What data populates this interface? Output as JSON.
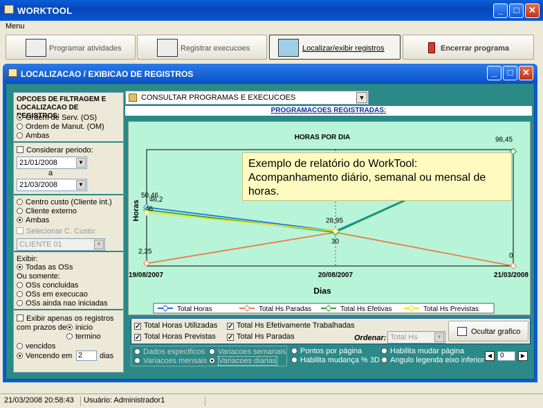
{
  "app": {
    "title": "WORKTOOL"
  },
  "menu": {
    "label": "Menu"
  },
  "toolbar": {
    "btn1": "Programar atividades",
    "btn2": "Registrar execucoes",
    "btn3": "Localizar/exibir registros",
    "btn4": "Encerrar programa"
  },
  "subwin": {
    "title": "LOCALIZACAO / EXIBICAO DE REGISTROS"
  },
  "filters": {
    "heading": "OPCOES DE FILTRAGEM E LOCALIZACAO DE REGISTROS:",
    "order_serv": "Ordem de Serv. (OS)",
    "order_manut": "Ordem de Manut. (OM)",
    "ambas1": "Ambas",
    "consider_period": "Considerar periodo:",
    "date_from": "21/01/2008",
    "date_sep": "a",
    "date_to": "21/03/2008",
    "centro_custo": "Centro custo (Cliente int.)",
    "cliente_externo": "Cliente externo",
    "ambas2": "Ambas",
    "select_cc": "Selecionar C. Custo:",
    "cliente_value": "CLIENTE 01",
    "exibir": "Exibir:",
    "todas_os": "Todas as OSs",
    "ou_somente": "Ou somente:",
    "os_concluidas": "OSs concluidas",
    "os_em_exec": "OSs em execucao",
    "os_nao_iniciadas": "OSs ainda nao iniciadas",
    "exibir_apenas": "Exibir apenas os registros",
    "com_prazos": "com prazos de",
    "inicio": "inicio",
    "termino": "termino",
    "vencidos": "vencidos",
    "vencendo_em": "Vencendo em",
    "dias_value": "2",
    "dias": "dias"
  },
  "main": {
    "consult_value": "CONSULTAR PROGRAMAS E EXECUCOES",
    "prog_title": "PROGRAMACOES REGISTRADAS:"
  },
  "chart_data": {
    "type": "line",
    "title": "HORAS POR DIA",
    "xlabel": "Dias",
    "ylabel": "Horas",
    "categories": [
      "19/08/2007",
      "20/08/2007",
      "21/03/2008"
    ],
    "series": [
      {
        "name": "Total Horas",
        "color": "#1f6fd6",
        "values": [
          50.46,
          30,
          98.45
        ]
      },
      {
        "name": "Total Hs Paradas",
        "color": "#f07a4a",
        "values": [
          2.25,
          28.95,
          0
        ]
      },
      {
        "name": "Total Hs Efetivas",
        "color": "#1aa830",
        "values": [
          48.2,
          28.95,
          98.45
        ]
      },
      {
        "name": "Total Hs Previstas",
        "color": "#f0e020",
        "values": [
          46,
          30,
          null
        ]
      }
    ],
    "data_labels": [
      "50,46",
      "46,2",
      "46",
      "2,25",
      "30",
      "28,95",
      "98,45",
      "0"
    ],
    "grid": true,
    "legend_position": "bottom"
  },
  "tooltip": {
    "line1": "Exemplo de relatório do WorkTool:",
    "line2": "Acompanhamento diário, semanal ou mensal de",
    "line3": "horas."
  },
  "controls": {
    "cb_total_util": "Total Horas Utilizadas",
    "cb_total_prev": "Total Horas Previstas",
    "cb_efet": "Total Hs Efetivamente Trabalhadas",
    "cb_paradas": "Total Hs Paradas",
    "ordenar": "Ordenar:",
    "ordenar_value": "Total Hs",
    "ocultar": "Ocultar grafico",
    "dados_especificos": "Dados especificos",
    "variacoes_mensais": "Variacoes mensais",
    "variacoes_semanais": "Variacoes semanais",
    "variacoes_diarias": "Variacoes diarias",
    "pontos_pagina": "Pontos por página",
    "habilita_mudanca": "Habilita mudança % 3D",
    "habilita_pagina": "Habilita mudar página",
    "angulo_legenda": "Angulo legenda eixo inferior",
    "page_value": "0"
  },
  "status": {
    "datetime": "21/03/2008 20:58:43",
    "user": "Usuário: Administrador1"
  }
}
